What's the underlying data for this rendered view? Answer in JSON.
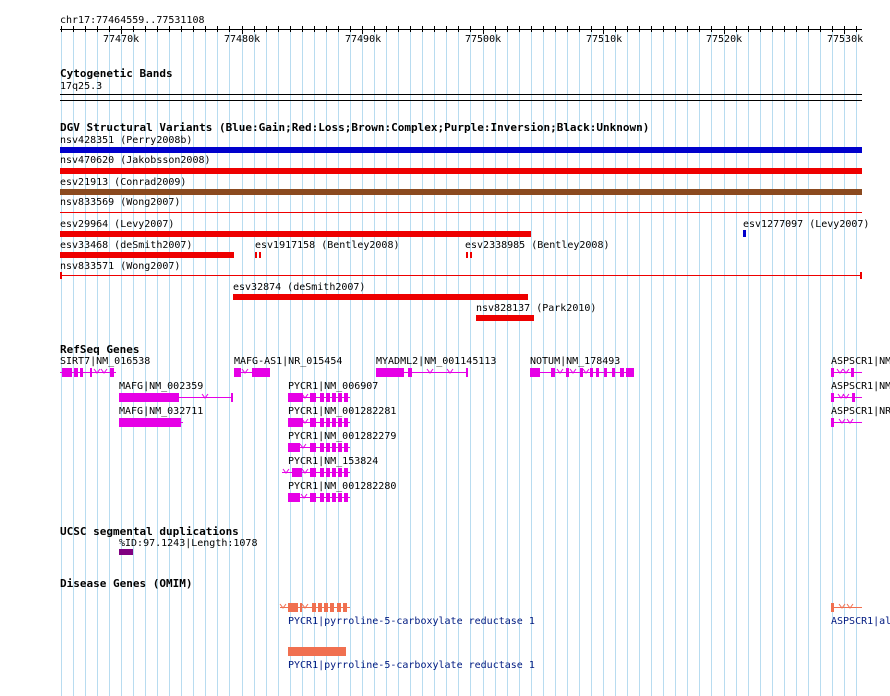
{
  "ruler": {
    "location": "chr17:77464559..77531108",
    "ticks": [
      {
        "label": "77470k",
        "pos": 77470000
      },
      {
        "label": "77480k",
        "pos": 77480000
      },
      {
        "label": "77490k",
        "pos": 77490000
      },
      {
        "label": "77500k",
        "pos": 77500000
      },
      {
        "label": "77510k",
        "pos": 77510000
      },
      {
        "label": "77520k",
        "pos": 77520000
      },
      {
        "label": "77530k",
        "pos": 77530000
      }
    ]
  },
  "tracks": {
    "cyto": {
      "title": "Cytogenetic Bands",
      "band": "17q25.3"
    },
    "dgv": {
      "title": "DGV Structural Variants (Blue:Gain;Red:Loss;Brown:Complex;Purple:Inversion;Black:Unknown)",
      "features": [
        {
          "label": "nsv428351 (Perry2008b)",
          "color": "#0000cc",
          "style": "thick"
        },
        {
          "label": "nsv470620 (Jakobsson2008)",
          "color": "#ee0000",
          "style": "thick"
        },
        {
          "label": "esv21913 (Conrad2009)",
          "color": "#8b4a1f",
          "style": "thick"
        },
        {
          "label": "nsv833569 (Wong2007)",
          "color": "#ee0000",
          "style": "thin"
        },
        {
          "label": "esv29964 (Levy2007)",
          "color": "#ee0000",
          "style": "thick"
        },
        {
          "label": "esv1277097 (Levy2007)",
          "color": "#0000cc",
          "style": "tick"
        },
        {
          "label": "esv33468 (deSmith2007)",
          "color": "#ee0000",
          "style": "thick"
        },
        {
          "label": "esv1917158 (Bentley2008)",
          "color": "#ee0000",
          "style": "small"
        },
        {
          "label": "esv2338985 (Bentley2008)",
          "color": "#ee0000",
          "style": "small"
        },
        {
          "label": "nsv833571 (Wong2007)",
          "color": "#ee0000",
          "style": "thinends"
        },
        {
          "label": "esv32874 (deSmith2007)",
          "color": "#ee0000",
          "style": "thick"
        },
        {
          "label": "nsv828137 (Park2010)",
          "color": "#ee0000",
          "style": "thick"
        }
      ]
    },
    "refseq": {
      "title": "RefSeq Genes",
      "genes": [
        {
          "label": "SIRT7|NM_016538"
        },
        {
          "label": "MAFG-AS1|NR_015454"
        },
        {
          "label": "MYADML2|NM_001145113"
        },
        {
          "label": "NOTUM|NM_178493"
        },
        {
          "label": "ASPSCR1|NM"
        },
        {
          "label": "MAFG|NM_002359"
        },
        {
          "label": "PYCR1|NM_006907"
        },
        {
          "label": "ASPSCR1|NM"
        },
        {
          "label": "MAFG|NM_032711"
        },
        {
          "label": "PYCR1|NM_001282281"
        },
        {
          "label": "ASPSCR1|NR"
        },
        {
          "label": "PYCR1|NM_001282279"
        },
        {
          "label": "PYCR1|NM_153824"
        },
        {
          "label": "PYCR1|NM_001282280"
        }
      ]
    },
    "segdup": {
      "title": "UCSC segmental duplications",
      "label": "%ID:97.1243|Length:1078"
    },
    "omim": {
      "title": "Disease Genes (OMIM)",
      "genes": [
        {
          "label": "PYCR1|pyrroline-5-carboxylate reductase 1"
        },
        {
          "label": "ASPSCR1|al"
        },
        {
          "label": "PYCR1|pyrroline-5-carboxylate reductase 1"
        }
      ]
    }
  },
  "colors": {
    "gridline": "#b8dcf0",
    "gene": "#e600e6",
    "omim": "#f07050",
    "segdup": "#800080",
    "label_navy": "#001a80"
  }
}
